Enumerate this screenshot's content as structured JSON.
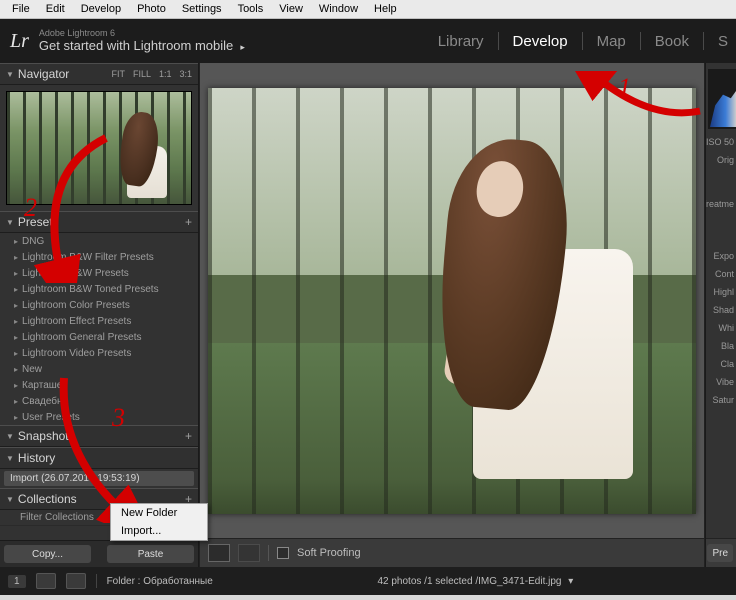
{
  "os_menu": [
    "File",
    "Edit",
    "Develop",
    "Photo",
    "Settings",
    "Tools",
    "View",
    "Window",
    "Help"
  ],
  "brand": {
    "mark": "Lr",
    "line1": "Adobe Lightroom 6",
    "line2": "Get started with Lightroom mobile"
  },
  "modules": {
    "items": [
      "Library",
      "Develop",
      "Map",
      "Book",
      "S"
    ],
    "active": "Develop"
  },
  "navigator": {
    "title": "Navigator",
    "modes": [
      "FIT",
      "FILL",
      "1:1",
      "3:1"
    ]
  },
  "presets": {
    "title": "Presets",
    "items": [
      "DNG",
      "Lightroom B&W Filter Presets",
      "Lightroom B&W Presets",
      "Lightroom B&W Toned Presets",
      "Lightroom Color Presets",
      "Lightroom Effect Presets",
      "Lightroom General Presets",
      "Lightroom Video Presets",
      "New",
      "Карташев",
      "Свадебне",
      "User Presets"
    ]
  },
  "snapshots": {
    "title": "Snapshots"
  },
  "history": {
    "title": "History",
    "items": [
      "Import (26.07.2019 19:53:19)"
    ]
  },
  "collections": {
    "title": "Collections",
    "filter_label": "Filter Collections"
  },
  "copy_paste": {
    "copy": "Copy...",
    "paste": "Paste"
  },
  "context_menu": {
    "new_folder": "New Folder",
    "import": "Import..."
  },
  "center_toolbar": {
    "soft_proofing": "Soft Proofing"
  },
  "right_strip": {
    "iso": "ISO 50",
    "orig": "Orig",
    "treatment": "Treatme",
    "labels": [
      "Expo",
      "Cont",
      "Highl",
      "Shad",
      "Whi",
      "Bla",
      "Cla",
      "Vibe",
      "Satur"
    ]
  },
  "right_button": {
    "prev": "Pre"
  },
  "footer": {
    "count_chip": "1",
    "folder_label": "Folder : Обработанные",
    "status": "42 photos /1 selected /IMG_3471-Edit.jpg"
  },
  "annotations": {
    "n1": "1",
    "n2": "2",
    "n3": "3"
  }
}
